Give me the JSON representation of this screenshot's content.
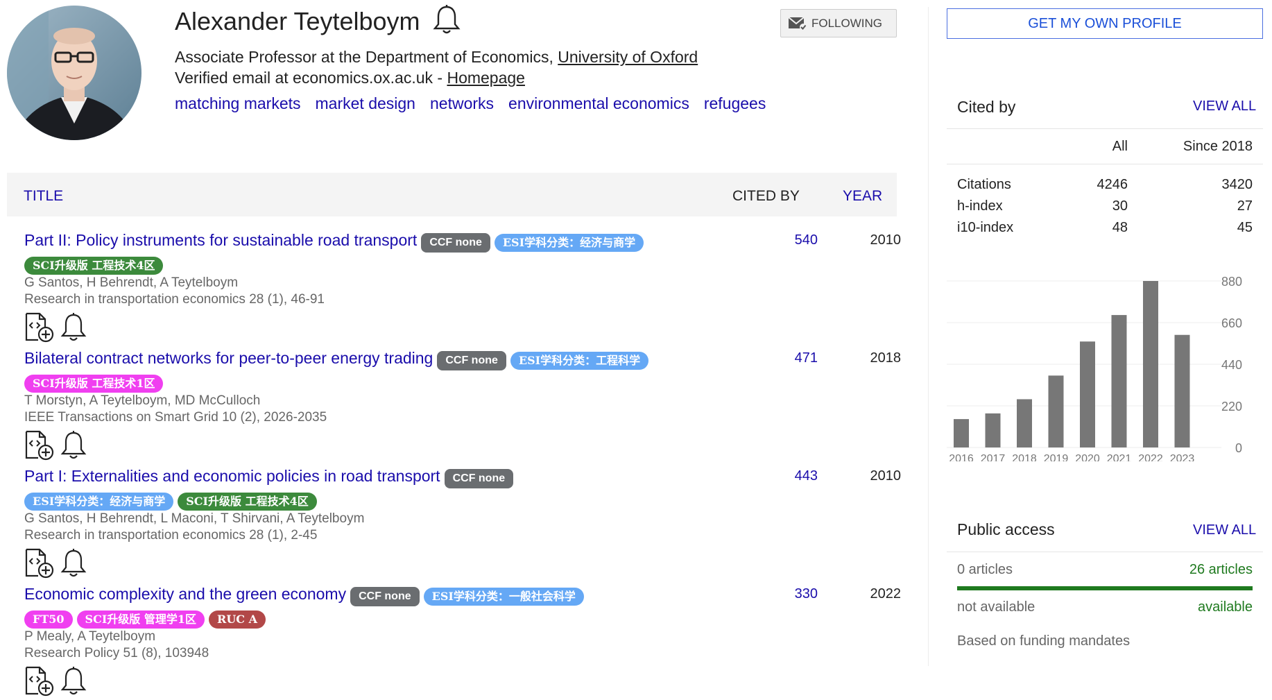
{
  "profile": {
    "name": "Alexander Teytelboym",
    "follow_label": "FOLLOWING",
    "affiliation_prefix": "Associate Professor at the Department of Economics, ",
    "affiliation_link": "University of Oxford",
    "email_text": "Verified email at economics.ox.ac.uk - ",
    "homepage_label": "Homepage",
    "interests": [
      "matching markets",
      "market design",
      "networks",
      "environmental economics",
      "refugees"
    ]
  },
  "table": {
    "col_title": "TITLE",
    "col_cited": "CITED BY",
    "col_year": "YEAR",
    "rows": [
      {
        "title": "Part II: Policy instruments for sustainable road transport",
        "tags_inline": [
          {
            "text": "CCF none",
            "kind": "ccf"
          },
          {
            "text": "ESI学科分类：经济与商学",
            "kind": "esi"
          }
        ],
        "tags_line2": [
          {
            "text": "SCI升级版 工程技术4区",
            "kind": "sci-green"
          }
        ],
        "authors": "G Santos, H Behrendt, A Teytelboym",
        "venue": "Research in transportation economics 28 (1), 46-91",
        "cited": "540",
        "year": "2010"
      },
      {
        "title": "Bilateral contract networks for peer-to-peer energy trading",
        "tags_inline": [
          {
            "text": "CCF none",
            "kind": "ccf"
          },
          {
            "text": "ESI学科分类：工程科学",
            "kind": "esi"
          }
        ],
        "tags_line2": [
          {
            "text": "SCI升级版 工程技术1区",
            "kind": "sci-pink"
          }
        ],
        "authors": "T Morstyn, A Teytelboym, MD McCulloch",
        "venue": "IEEE Transactions on Smart Grid 10 (2), 2026-2035",
        "cited": "471",
        "year": "2018"
      },
      {
        "title": "Part I: Externalities and economic policies in road transport",
        "tags_inline": [
          {
            "text": "CCF none",
            "kind": "ccf"
          }
        ],
        "tags_line2": [
          {
            "text": "ESI学科分类：经济与商学",
            "kind": "esi"
          },
          {
            "text": "SCI升级版 工程技术4区",
            "kind": "sci-green"
          }
        ],
        "authors": "G Santos, H Behrendt, L Maconi, T Shirvani, A Teytelboym",
        "venue": "Research in transportation economics 28 (1), 2-45",
        "cited": "443",
        "year": "2010"
      },
      {
        "title": "Economic complexity and the green economy",
        "tags_inline": [
          {
            "text": "CCF none",
            "kind": "ccf"
          },
          {
            "text": "ESI学科分类：一般社会科学",
            "kind": "esi"
          }
        ],
        "tags_line2": [
          {
            "text": "FT50",
            "kind": "ft"
          },
          {
            "text": "SCI升级版 管理学1区",
            "kind": "sci-pink"
          },
          {
            "text": "RUC A",
            "kind": "ruc"
          }
        ],
        "authors": "P Mealy, A Teytelboym",
        "venue": "Research Policy 51 (8), 103948",
        "cited": "330",
        "year": "2022"
      }
    ]
  },
  "sidebar": {
    "get_profile_label": "GET MY OWN PROFILE",
    "cited_by": {
      "title": "Cited by",
      "view_all": "VIEW ALL",
      "col_all": "All",
      "col_since": "Since 2018",
      "rows": [
        {
          "label": "Citations",
          "all": "4246",
          "since": "3420"
        },
        {
          "label": "h-index",
          "all": "30",
          "since": "27"
        },
        {
          "label": "i10-index",
          "all": "48",
          "since": "45"
        }
      ]
    },
    "public_access": {
      "title": "Public access",
      "view_all": "VIEW ALL",
      "left_count": "0 articles",
      "right_count": "26 articles",
      "left_status": "not available",
      "right_status": "available",
      "note": "Based on funding mandates"
    }
  },
  "chart_data": {
    "type": "bar",
    "categories": [
      "2016",
      "2017",
      "2018",
      "2019",
      "2020",
      "2021",
      "2022",
      "2023"
    ],
    "values": [
      150,
      180,
      255,
      380,
      560,
      700,
      880,
      595
    ],
    "ylim": [
      0,
      880
    ],
    "yticks": [
      "880",
      "660",
      "440",
      "220",
      "0"
    ],
    "bar_color": "#777777"
  },
  "colors": {
    "link": "#1a0dab",
    "accent_green": "#1f7a1f"
  }
}
